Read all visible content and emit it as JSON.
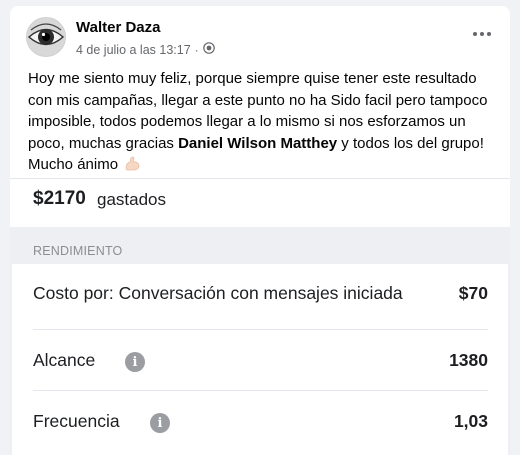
{
  "post": {
    "author": "Walter Daza",
    "date": "4 de julio a las 13:17",
    "separator": "·",
    "more_label": "···",
    "text_part1": "Hoy me siento muy feliz, porque siempre quise tener este resultado con mis campañas, llegar a este punto no ha Sido facil pero tampoco imposible, todos podemos llegar a lo mismo si nos esforzamos un poco, muchas gracias ",
    "mention": "Daniel Wilson Matthey",
    "text_part2": " y todos los del grupo! Mucho ánimo ",
    "emoji": "flexed-biceps-emoji"
  },
  "report": {
    "spend_amount": "$2170",
    "spend_label": "gastados",
    "section_title": "RENDIMIENTO",
    "rows": [
      {
        "label": "Costo por: Conversación con mensajes iniciada",
        "value": "$70",
        "info": false
      },
      {
        "label": "Alcance",
        "value": "1380",
        "info": true,
        "info_icon": "i"
      },
      {
        "label": "Frecuencia",
        "value": "1,03",
        "info": true,
        "info_icon": "i"
      }
    ]
  },
  "colors": {
    "background": "#f0f2f5",
    "card": "#ffffff",
    "secondary_text": "#65676b",
    "info_icon": "#9a9da1"
  }
}
